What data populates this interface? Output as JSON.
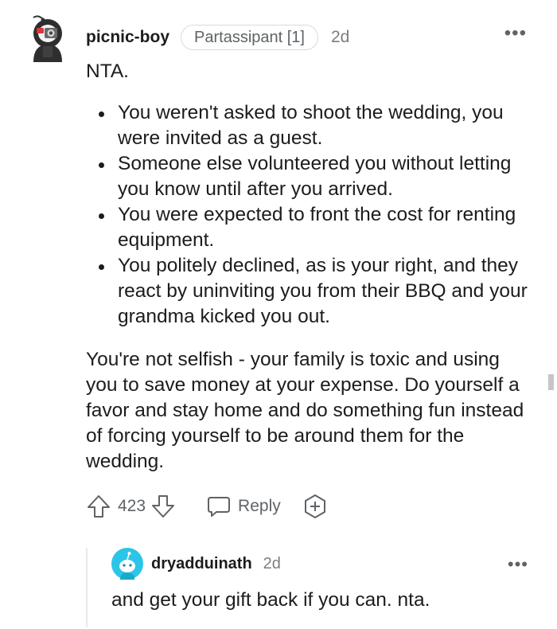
{
  "comment": {
    "username": "picnic-boy",
    "flair": "Partassipant [1]",
    "timestamp": "2d",
    "more_label": "•••",
    "intro": "NTA.",
    "bullets": [
      "You weren't asked to shoot the wedding, you were invited as a guest.",
      "Someone else volunteered you without letting you know until after you arrived.",
      "You were expected to front the cost for renting equipment.",
      "You politely declined, as is your right, and they react by uninviting you from their BBQ and your grandma kicked you out."
    ],
    "closing": "You're not selfish - your family is toxic and using you to save money at your expense. Do yourself a favor and stay home and do something fun instead of forcing yourself to be around them for the wedding.",
    "score": "423",
    "reply_label": "Reply"
  },
  "reply": {
    "username": "dryadduinath",
    "timestamp": "2d",
    "more_label": "•••",
    "text": "and get your gift back if you can. nta."
  },
  "colors": {
    "text": "#1c1c1c",
    "meta": "#7a7e82",
    "icon": "#5f6366",
    "reply_avatar": "#2cc5e8"
  }
}
